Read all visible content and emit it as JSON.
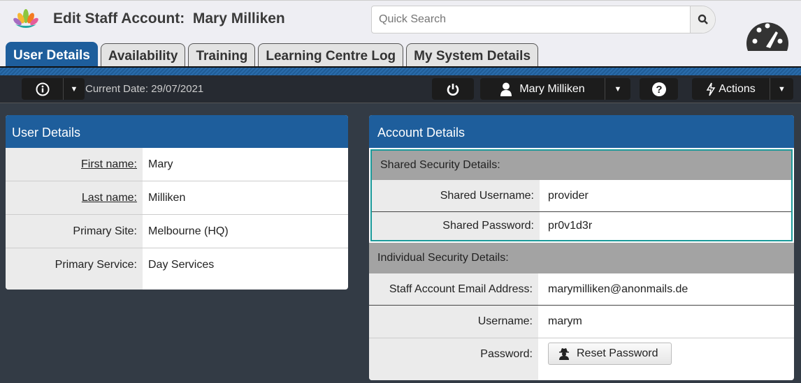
{
  "header": {
    "title": "Edit Staff Account:  Mary Milliken",
    "search_placeholder": "Quick Search"
  },
  "tabs": [
    "User Details",
    "Availability",
    "Training",
    "Learning Centre Log",
    "My System Details"
  ],
  "toolbar": {
    "current_date": "Current Date: 29/07/2021",
    "user": "Mary Milliken",
    "actions": "Actions"
  },
  "user_details": {
    "title": "User Details",
    "rows": [
      {
        "label": "First name:",
        "value": "Mary"
      },
      {
        "label": "Last name:",
        "value": "Milliken"
      },
      {
        "label": "Primary Site:",
        "value": "Melbourne (HQ)"
      },
      {
        "label": "Primary Service:",
        "value": "Day Services"
      }
    ]
  },
  "account_details": {
    "title": "Account Details",
    "shared_header": "Shared Security Details:",
    "shared_rows": [
      {
        "label": "Shared Username:",
        "value": "provider"
      },
      {
        "label": "Shared Password:",
        "value": "pr0v1d3r"
      }
    ],
    "individual_header": "Individual Security Details:",
    "individual_rows": [
      {
        "label": "Staff Account Email Address:",
        "value": "marymilliken@anonmails.de"
      },
      {
        "label": "Username:",
        "value": "marym"
      },
      {
        "label": "Password:"
      }
    ],
    "reset_password": "Reset Password"
  },
  "colors": {
    "brand_blue": "#1e5e9c",
    "highlight": "#1a9a9a"
  }
}
